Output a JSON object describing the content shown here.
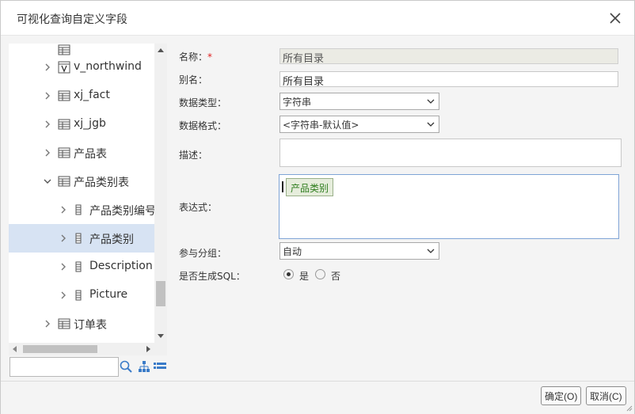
{
  "dialog": {
    "title": "可视化查询自定义字段"
  },
  "tree": {
    "items": [
      {
        "label": "v_northwind",
        "icon": "view-icon",
        "expanded": false,
        "level": 1
      },
      {
        "label": "xj_fact",
        "icon": "table-icon",
        "expanded": false,
        "level": 1
      },
      {
        "label": "xj_jgb",
        "icon": "table-icon",
        "expanded": false,
        "level": 1
      },
      {
        "label": "产品表",
        "icon": "table-icon",
        "expanded": false,
        "level": 1
      },
      {
        "label": "产品类别表",
        "icon": "table-icon",
        "expanded": true,
        "level": 1
      },
      {
        "label": "产品类别编号",
        "icon": "field-icon",
        "expanded": false,
        "level": 2
      },
      {
        "label": "产品类别",
        "icon": "field-icon",
        "expanded": false,
        "level": 2,
        "selected": true
      },
      {
        "label": "Description",
        "icon": "field-icon",
        "expanded": false,
        "level": 2
      },
      {
        "label": "Picture",
        "icon": "field-icon",
        "expanded": false,
        "level": 2
      },
      {
        "label": "订单表",
        "icon": "table-icon",
        "expanded": false,
        "level": 1
      }
    ],
    "search_value": ""
  },
  "form": {
    "name_label": "名称：",
    "name_required": "*",
    "name_value": "所有目录",
    "alias_label": "别名：",
    "alias_value": "所有目录",
    "datatype_label": "数据类型：",
    "datatype_value": "字符串",
    "format_label": "数据格式：",
    "format_value": "<字符串-默认值>",
    "desc_label": "描述：",
    "desc_value": "",
    "expr_label": "表达式：",
    "expr_tag": "产品类别",
    "group_label": "参与分组：",
    "group_value": "自动",
    "sql_label": "是否生成SQL：",
    "sql_yes": "是",
    "sql_no": "否",
    "sql_selected": "是"
  },
  "buttons": {
    "ok": "确定(O)",
    "cancel": "取消(C)"
  },
  "colors": {
    "selected_row": "#d7e3f3",
    "required": "#e02020",
    "tag_text": "#2e7d1e",
    "tag_bg": "#e6eddc",
    "expr_border": "#7fa4d6"
  }
}
